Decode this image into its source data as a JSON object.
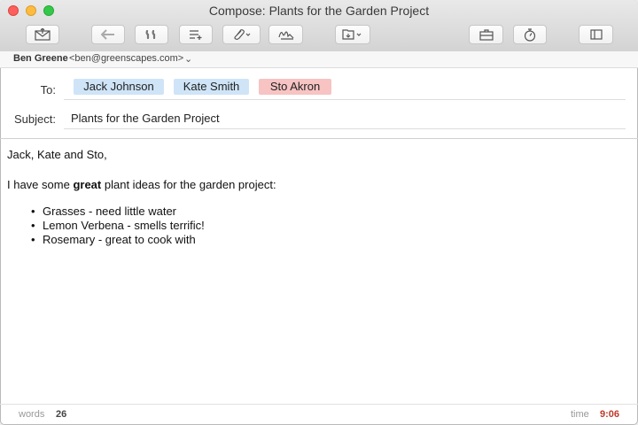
{
  "window": {
    "title": "Compose: Plants for the Garden Project"
  },
  "toolbar": {
    "buttons": [
      {
        "name": "send",
        "icon": "send-envelope-icon"
      },
      {
        "name": "reply",
        "icon": "reply-arrow-icon"
      },
      {
        "name": "quote",
        "icon": "quote-icon"
      },
      {
        "name": "format",
        "icon": "format-list-icon"
      },
      {
        "name": "attach",
        "icon": "paperclip-icon"
      },
      {
        "name": "signature",
        "icon": "signature-icon"
      },
      {
        "name": "folder",
        "icon": "folder-icon"
      },
      {
        "name": "briefcase",
        "icon": "briefcase-icon"
      },
      {
        "name": "timer",
        "icon": "timer-icon"
      },
      {
        "name": "sidebar",
        "icon": "sidebar-icon"
      }
    ]
  },
  "from": {
    "name": "Ben Greene",
    "email": "<ben@greenscapes.com>",
    "chevron": "⌄"
  },
  "to": {
    "label": "To:",
    "recipients": [
      {
        "name": "Jack Johnson",
        "color": "#cfe4f7"
      },
      {
        "name": "Kate Smith",
        "color": "#cfe4f7"
      },
      {
        "name": "Sto Akron",
        "color": "#f7c3c3"
      }
    ]
  },
  "subject": {
    "label": "Subject:",
    "value": "Plants for the Garden Project"
  },
  "body": {
    "greeting": "Jack, Kate and Sto,",
    "intro_pre": "I have some",
    "intro_bold": "great",
    "intro_post": "plant ideas for the garden project:",
    "bullet_char": "•",
    "items": [
      "Grasses - need little water",
      "Lemon Verbena - smells terrific!",
      "Rosemary - great to cook with"
    ]
  },
  "status": {
    "words_label": "words",
    "words_value": "26",
    "time_label": "time",
    "time_value": "9:06",
    "time_color": "#c0392b"
  }
}
